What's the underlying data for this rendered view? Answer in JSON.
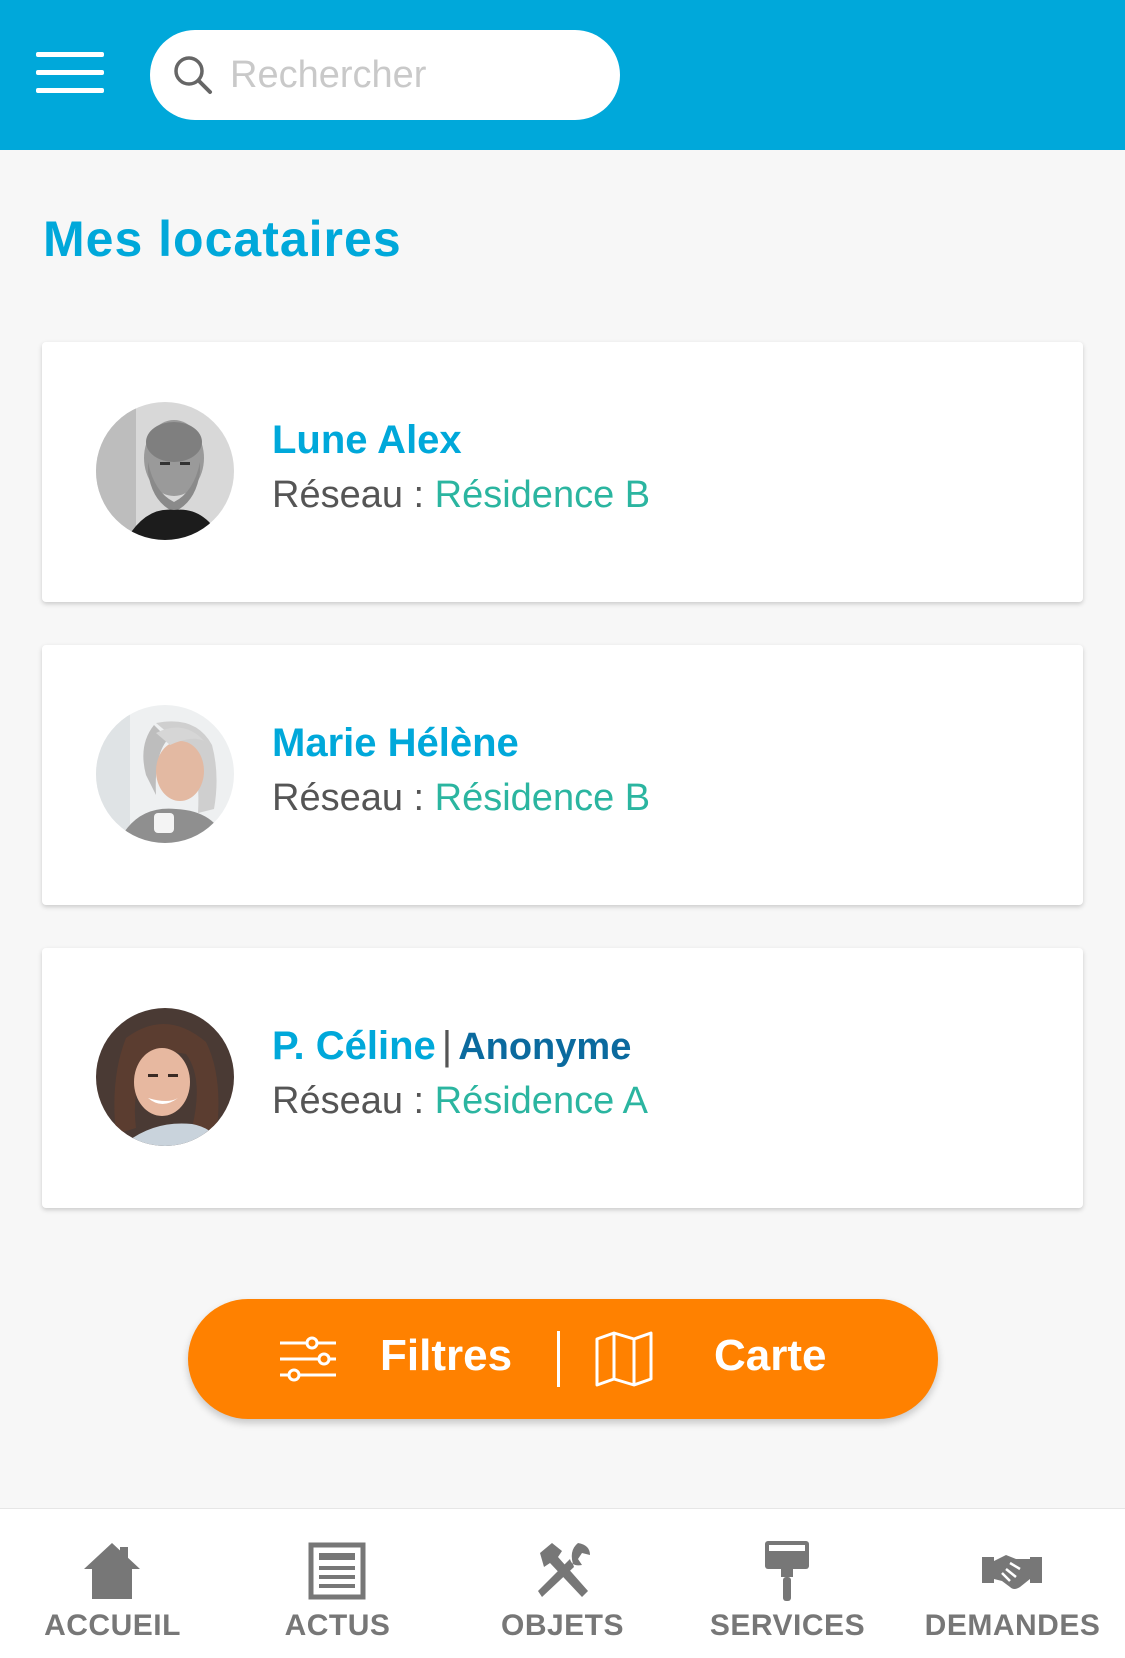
{
  "header": {
    "search_placeholder": "Rechercher",
    "menu_icon": "hamburger-menu-icon",
    "search_icon": "search-icon",
    "background_color": "#00a8da"
  },
  "page": {
    "title": "Mes locataires"
  },
  "tenants": [
    {
      "name": "Lune Alex",
      "network_label": "Réseau :",
      "network": "Résidence B"
    },
    {
      "name": "Marie Hélène",
      "network_label": "Réseau :",
      "network": "Résidence B"
    },
    {
      "name": "P. Céline",
      "separator": "|",
      "status": "Anonyme",
      "network_label": "Réseau :",
      "network": "Résidence A"
    }
  ],
  "actions": {
    "filters_label": "Filtres",
    "map_label": "Carte",
    "filters_icon": "sliders-icon",
    "map_icon": "map-icon",
    "color": "#ff8100"
  },
  "bottom_nav": [
    {
      "label": "ACCUEIL",
      "icon": "home-icon"
    },
    {
      "label": "ACTUS",
      "icon": "newspaper-icon"
    },
    {
      "label": "OBJETS",
      "icon": "tools-icon"
    },
    {
      "label": "SERVICES",
      "icon": "paint-roller-icon"
    },
    {
      "label": "DEMANDES",
      "icon": "handshake-icon"
    }
  ],
  "colors": {
    "accent": "#00a8da",
    "network_value": "#2bb5a0",
    "anonymous": "#0b6a9e"
  }
}
